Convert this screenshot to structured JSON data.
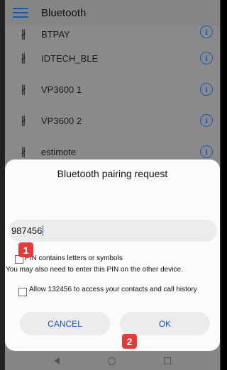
{
  "app": {
    "title": "Bluetooth"
  },
  "devices": [
    {
      "name": "BTPAY"
    },
    {
      "name": "IDTECH_BLE"
    },
    {
      "name": "VP3600 1"
    },
    {
      "name": "VP3600 2"
    },
    {
      "name": "estimote"
    }
  ],
  "icons": {
    "bluetooth": "bluetooth-icon",
    "info": "info-icon",
    "menu": "hamburger-menu-icon",
    "nav": [
      "back-icon",
      "home-icon",
      "recent-apps-icon"
    ]
  },
  "glyphs": {
    "bluetooth": "∦",
    "info": "i"
  },
  "dialog": {
    "title": "Bluetooth pairing request",
    "pin_value": "987456",
    "letters_label": "PIN contains letters or symbols",
    "hint": "You may also need to enter this PIN on the other device.",
    "allow_label": "Allow 132456 to access your contacts and call history",
    "cancel_label": "CANCEL",
    "ok_label": "OK"
  },
  "markers": {
    "one": "1",
    "two": "2"
  },
  "colors": {
    "accent": "#1a56b8",
    "marker": "#e33a3a",
    "dialog_bg": "#fbfbfb"
  }
}
